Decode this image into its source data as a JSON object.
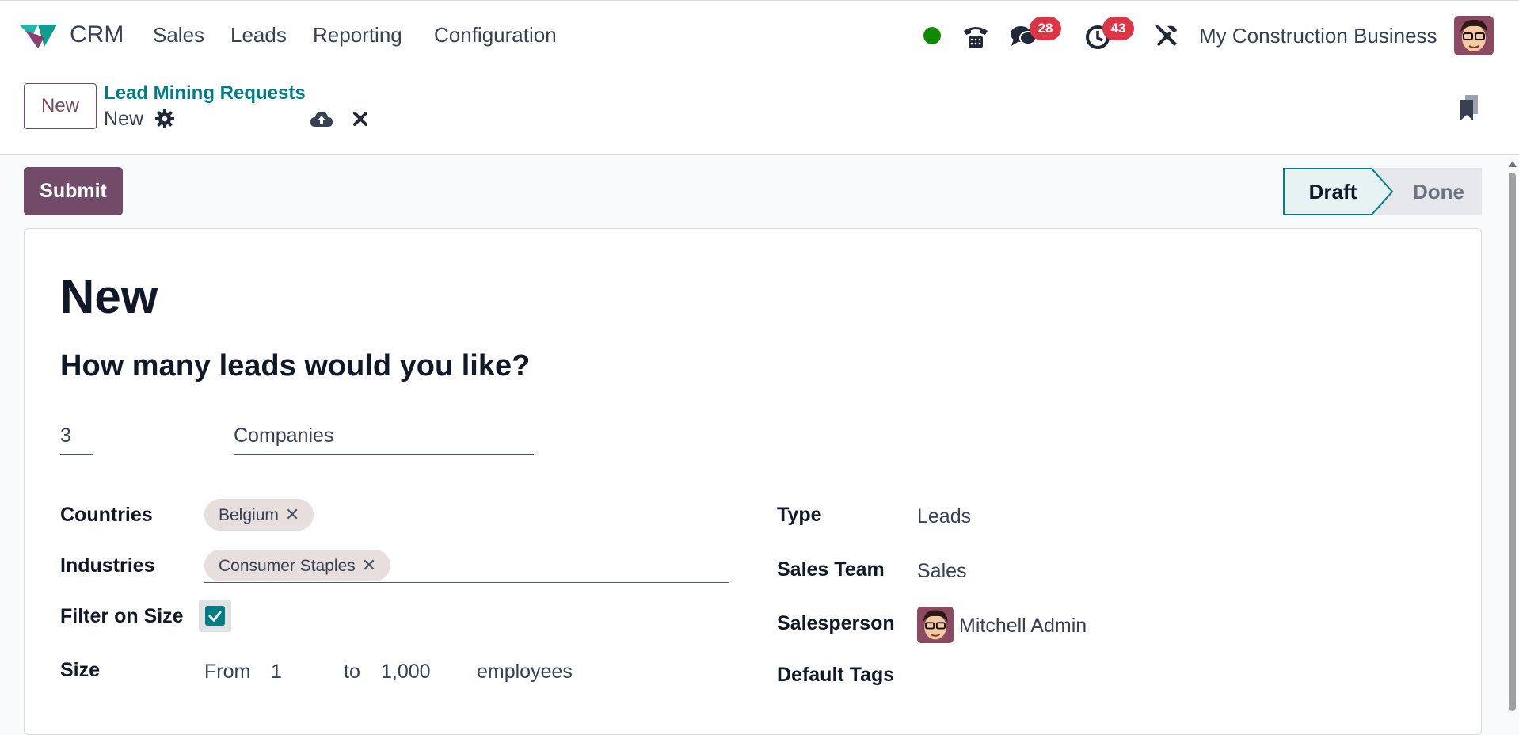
{
  "navbar": {
    "app_name": "CRM",
    "menu": [
      "Sales",
      "Leads",
      "Reporting",
      "Configuration"
    ],
    "messages_count": "28",
    "activities_count": "43",
    "company": "My Construction Business",
    "icons": [
      "phone-icon",
      "chat-icon",
      "clock-icon",
      "tools-icon"
    ],
    "status_color": "#108a00"
  },
  "control_panel": {
    "new_label": "New",
    "breadcrumb": "Lead Mining Requests",
    "current": "New"
  },
  "actions": {
    "submit_label": "Submit"
  },
  "statusbar": {
    "stages": [
      "Draft",
      "Done"
    ],
    "active": "Draft"
  },
  "form": {
    "title": "New",
    "question": "How many leads would you like?",
    "lead_count": "3",
    "search_type": "Companies",
    "countries_label": "Countries",
    "countries": [
      "Belgium"
    ],
    "industries_label": "Industries",
    "industries": [
      "Consumer Staples"
    ],
    "filter_size_label": "Filter on Size",
    "filter_size_checked": true,
    "size_label": "Size",
    "size_from_label": "From",
    "size_from": "1",
    "size_to_label": "to",
    "size_to": "1,000",
    "size_unit": "employees",
    "type_label": "Type",
    "type_value": "Leads",
    "team_label": "Sales Team",
    "team_value": "Sales",
    "salesperson_label": "Salesperson",
    "salesperson_value": "Mitchell Admin",
    "tags_label": "Default Tags"
  },
  "colors": {
    "brand": "#714b67",
    "link": "#017e84",
    "badge": "#dc3545"
  }
}
